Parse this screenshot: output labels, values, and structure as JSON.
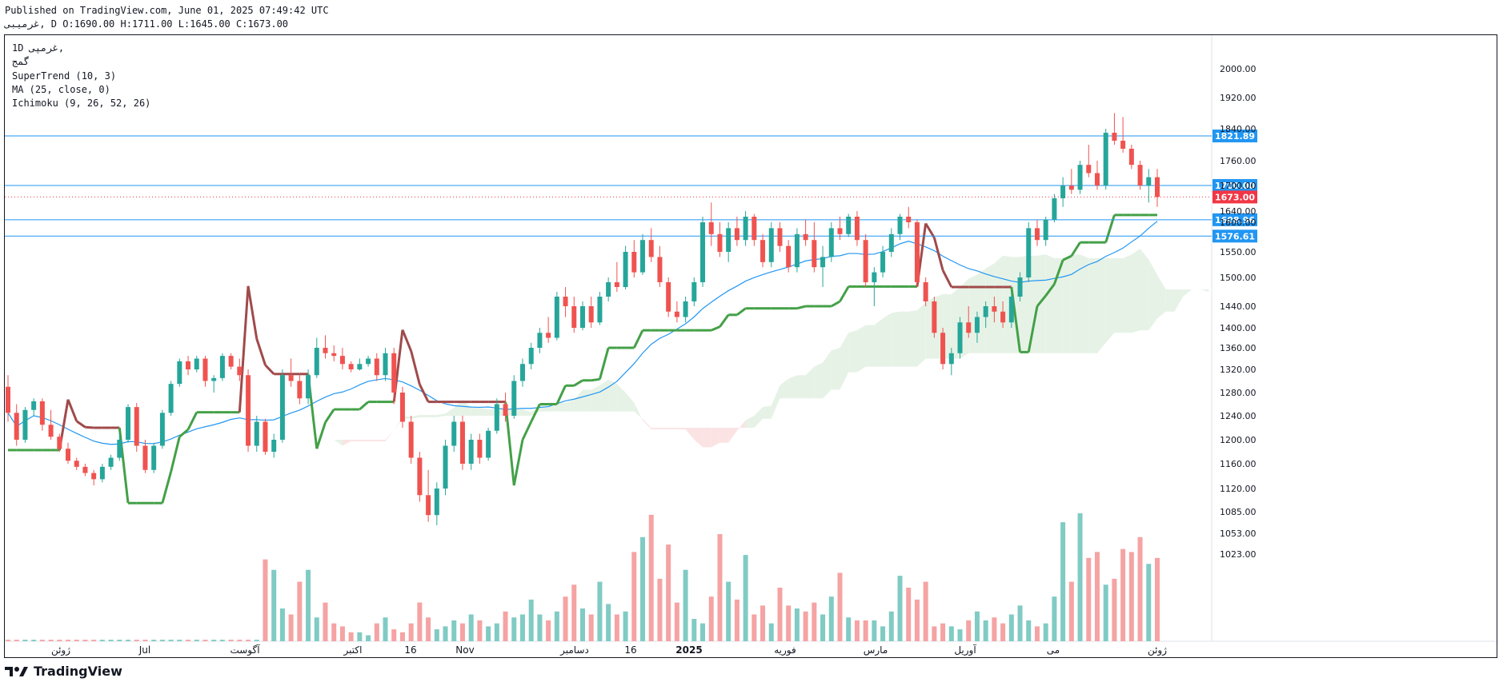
{
  "header": {
    "published": "Published on TradingView.com, June 01, 2025 07:49:42 UTC",
    "ohlc": "غرميبی, D O:1690.00 H:1711.00 L:1645.00 C:1673.00"
  },
  "legend": {
    "interval": "1D  غرمپی,",
    "symbol_name": "گمج",
    "supertrend": "SuperTrend (10, 3)",
    "ma": "MA (25, close, 0)",
    "ichimoku": "Ichimoku (9, 26, 52, 26)"
  },
  "brand": {
    "name": "TradingView",
    "icon": "tradingview-logo-icon"
  },
  "colors": {
    "up": "#26a69a",
    "down": "#ef5350",
    "supertrend_up": "#43a047",
    "supertrend_down": "#a04a4a",
    "ma": "#2196f3",
    "hline": "#2196f3",
    "cloud_bull": "#e6f2e6",
    "cloud_bear": "#fbe3e3",
    "last_price": "#f23645"
  },
  "chart_data": {
    "type": "candlestick",
    "y_axis": {
      "ticks": [
        2000,
        1920,
        1840,
        1760,
        1700,
        1640,
        1600,
        1550,
        1500,
        1440,
        1400,
        1360,
        1320,
        1280,
        1240,
        1200,
        1160,
        1120,
        1085,
        1053,
        1023
      ],
      "tick_labels": [
        "2000.00",
        "1920.00",
        "1840.00",
        "1760.00",
        "1700.00",
        "1640.00",
        "1600.00",
        "1550.00",
        "1500.00",
        "1440.00",
        "1400.00",
        "1360.00",
        "1320.00",
        "1280.00",
        "1240.00",
        "1200.00",
        "1160.00",
        "1120.00",
        "1085.00",
        "1053.00",
        "1023.00"
      ],
      "scale": "log"
    },
    "x_axis": {
      "tick_labels": [
        "ژوئن",
        "Jul",
        "آگوست",
        "اکتبر",
        "16",
        "Nov",
        "دسامبر",
        "16",
        "2025",
        "فوریه",
        "مارس",
        "آوریل",
        "می",
        "ژوئن"
      ]
    },
    "horizontal_lines": [
      {
        "value": 1821.89,
        "label": "1821.89"
      },
      {
        "value": 1700.0,
        "label": "1700.00"
      },
      {
        "value": 1608.96,
        "label": "1608.96"
      },
      {
        "value": 1576.61,
        "label": "1576.61"
      }
    ],
    "last_price": {
      "value": 1673.0,
      "label": "1673.00"
    },
    "candles": [
      [
        1290,
        1310,
        1230,
        1245
      ],
      [
        1245,
        1260,
        1190,
        1200
      ],
      [
        1200,
        1255,
        1195,
        1250
      ],
      [
        1250,
        1270,
        1240,
        1265
      ],
      [
        1265,
        1270,
        1215,
        1225
      ],
      [
        1225,
        1250,
        1200,
        1205
      ],
      [
        1205,
        1210,
        1180,
        1185
      ],
      [
        1185,
        1195,
        1160,
        1165
      ],
      [
        1165,
        1170,
        1150,
        1155
      ],
      [
        1155,
        1160,
        1140,
        1145
      ],
      [
        1145,
        1150,
        1125,
        1135
      ],
      [
        1135,
        1160,
        1130,
        1155
      ],
      [
        1155,
        1175,
        1150,
        1170
      ],
      [
        1170,
        1210,
        1165,
        1200
      ],
      [
        1200,
        1260,
        1195,
        1255
      ],
      [
        1255,
        1262,
        1180,
        1190
      ],
      [
        1190,
        1200,
        1145,
        1150
      ],
      [
        1150,
        1195,
        1145,
        1190
      ],
      [
        1190,
        1250,
        1185,
        1245
      ],
      [
        1245,
        1300,
        1240,
        1295
      ],
      [
        1295,
        1340,
        1290,
        1335
      ],
      [
        1335,
        1345,
        1310,
        1320
      ],
      [
        1320,
        1345,
        1315,
        1340
      ],
      [
        1340,
        1345,
        1290,
        1300
      ],
      [
        1300,
        1310,
        1280,
        1305
      ],
      [
        1305,
        1350,
        1300,
        1345
      ],
      [
        1345,
        1350,
        1320,
        1325
      ],
      [
        1325,
        1340,
        1300,
        1310
      ],
      [
        1310,
        1320,
        1180,
        1190
      ],
      [
        1190,
        1240,
        1180,
        1230
      ],
      [
        1230,
        1235,
        1175,
        1180
      ],
      [
        1180,
        1210,
        1170,
        1200
      ],
      [
        1200,
        1320,
        1195,
        1310
      ],
      [
        1310,
        1340,
        1290,
        1300
      ],
      [
        1300,
        1310,
        1260,
        1270
      ],
      [
        1270,
        1320,
        1260,
        1310
      ],
      [
        1310,
        1380,
        1305,
        1360
      ],
      [
        1360,
        1385,
        1340,
        1350
      ],
      [
        1350,
        1365,
        1335,
        1345
      ],
      [
        1345,
        1360,
        1320,
        1330
      ],
      [
        1330,
        1335,
        1315,
        1320
      ],
      [
        1320,
        1340,
        1318,
        1330
      ],
      [
        1330,
        1345,
        1325,
        1340
      ],
      [
        1340,
        1350,
        1300,
        1310
      ],
      [
        1310,
        1360,
        1300,
        1350
      ],
      [
        1350,
        1360,
        1260,
        1280
      ],
      [
        1280,
        1290,
        1220,
        1230
      ],
      [
        1230,
        1240,
        1160,
        1170
      ],
      [
        1170,
        1180,
        1100,
        1110
      ],
      [
        1110,
        1150,
        1070,
        1080
      ],
      [
        1080,
        1130,
        1065,
        1120
      ],
      [
        1120,
        1200,
        1110,
        1190
      ],
      [
        1190,
        1240,
        1180,
        1230
      ],
      [
        1230,
        1240,
        1150,
        1160
      ],
      [
        1160,
        1210,
        1150,
        1200
      ],
      [
        1200,
        1210,
        1160,
        1170
      ],
      [
        1170,
        1220,
        1165,
        1215
      ],
      [
        1215,
        1270,
        1210,
        1260
      ],
      [
        1260,
        1280,
        1230,
        1240
      ],
      [
        1240,
        1310,
        1235,
        1300
      ],
      [
        1300,
        1340,
        1290,
        1330
      ],
      [
        1330,
        1370,
        1320,
        1360
      ],
      [
        1360,
        1400,
        1350,
        1390
      ],
      [
        1390,
        1420,
        1370,
        1380
      ],
      [
        1380,
        1470,
        1375,
        1460
      ],
      [
        1460,
        1480,
        1420,
        1440
      ],
      [
        1440,
        1460,
        1390,
        1400
      ],
      [
        1400,
        1450,
        1395,
        1440
      ],
      [
        1440,
        1460,
        1400,
        1410
      ],
      [
        1410,
        1470,
        1405,
        1460
      ],
      [
        1460,
        1500,
        1450,
        1490
      ],
      [
        1490,
        1530,
        1470,
        1480
      ],
      [
        1480,
        1560,
        1475,
        1550
      ],
      [
        1550,
        1570,
        1500,
        1510
      ],
      [
        1510,
        1580,
        1505,
        1570
      ],
      [
        1570,
        1590,
        1530,
        1540
      ],
      [
        1540,
        1560,
        1480,
        1490
      ],
      [
        1490,
        1500,
        1420,
        1430
      ],
      [
        1430,
        1450,
        1410,
        1420
      ],
      [
        1420,
        1460,
        1410,
        1450
      ],
      [
        1450,
        1500,
        1440,
        1490
      ],
      [
        1490,
        1620,
        1480,
        1600
      ],
      [
        1600,
        1660,
        1560,
        1580
      ],
      [
        1580,
        1600,
        1540,
        1550
      ],
      [
        1550,
        1600,
        1530,
        1590
      ],
      [
        1590,
        1620,
        1560,
        1570
      ],
      [
        1570,
        1640,
        1560,
        1620
      ],
      [
        1620,
        1630,
        1560,
        1570
      ],
      [
        1570,
        1580,
        1520,
        1530
      ],
      [
        1530,
        1600,
        1520,
        1590
      ],
      [
        1590,
        1600,
        1550,
        1560
      ],
      [
        1560,
        1570,
        1510,
        1520
      ],
      [
        1520,
        1590,
        1510,
        1580
      ],
      [
        1580,
        1610,
        1560,
        1570
      ],
      [
        1570,
        1600,
        1510,
        1520
      ],
      [
        1520,
        1560,
        1480,
        1540
      ],
      [
        1540,
        1600,
        1530,
        1590
      ],
      [
        1590,
        1620,
        1570,
        1580
      ],
      [
        1580,
        1630,
        1575,
        1620
      ],
      [
        1620,
        1640,
        1560,
        1570
      ],
      [
        1570,
        1580,
        1480,
        1490
      ],
      [
        1490,
        1520,
        1440,
        1510
      ],
      [
        1510,
        1560,
        1500,
        1550
      ],
      [
        1550,
        1590,
        1540,
        1580
      ],
      [
        1580,
        1630,
        1570,
        1620
      ],
      [
        1620,
        1650,
        1590,
        1600
      ],
      [
        1600,
        1610,
        1480,
        1490
      ],
      [
        1490,
        1500,
        1440,
        1450
      ],
      [
        1450,
        1460,
        1380,
        1390
      ],
      [
        1390,
        1400,
        1320,
        1330
      ],
      [
        1330,
        1360,
        1310,
        1350
      ],
      [
        1350,
        1420,
        1340,
        1410
      ],
      [
        1410,
        1440,
        1380,
        1390
      ],
      [
        1390,
        1430,
        1370,
        1420
      ],
      [
        1420,
        1450,
        1400,
        1440
      ],
      [
        1440,
        1460,
        1410,
        1430
      ],
      [
        1430,
        1450,
        1400,
        1410
      ],
      [
        1410,
        1470,
        1400,
        1460
      ],
      [
        1460,
        1510,
        1450,
        1500
      ],
      [
        1500,
        1600,
        1490,
        1590
      ],
      [
        1590,
        1610,
        1560,
        1570
      ],
      [
        1570,
        1620,
        1560,
        1610
      ],
      [
        1610,
        1680,
        1600,
        1670
      ],
      [
        1670,
        1720,
        1650,
        1700
      ],
      [
        1700,
        1740,
        1680,
        1690
      ],
      [
        1690,
        1760,
        1680,
        1750
      ],
      [
        1750,
        1800,
        1720,
        1730
      ],
      [
        1730,
        1760,
        1690,
        1700
      ],
      [
        1700,
        1840,
        1690,
        1830
      ],
      [
        1830,
        1880,
        1800,
        1810
      ],
      [
        1810,
        1870,
        1780,
        1790
      ],
      [
        1790,
        1800,
        1740,
        1750
      ],
      [
        1750,
        1760,
        1690,
        1700
      ],
      [
        1700,
        1740,
        1660,
        1720
      ],
      [
        1720,
        1740,
        1650,
        1673
      ]
    ],
    "volume": [
      1,
      1,
      1,
      1,
      1,
      1,
      1,
      1,
      1,
      1,
      1,
      1,
      1,
      1,
      1,
      1,
      1,
      1,
      1,
      1,
      1,
      1,
      1,
      1,
      1,
      1,
      1,
      1,
      1,
      1,
      55,
      48,
      22,
      18,
      40,
      48,
      16,
      26,
      12,
      10,
      6,
      6,
      4,
      12,
      16,
      8,
      6,
      12,
      26,
      16,
      8,
      10,
      14,
      12,
      18,
      14,
      10,
      12,
      20,
      16,
      18,
      28,
      18,
      14,
      20,
      30,
      38,
      22,
      18,
      40,
      25,
      18,
      20,
      60,
      70,
      85,
      42,
      65,
      26,
      48,
      15,
      12,
      30,
      72,
      40,
      28,
      58,
      18,
      24,
      12,
      36,
      24,
      22,
      20,
      26,
      18,
      30,
      46,
      16,
      14,
      14,
      14,
      10,
      20,
      44,
      36,
      28,
      40,
      10,
      12,
      10,
      8,
      14,
      20,
      14,
      16,
      12,
      18,
      24,
      14,
      10,
      12,
      30,
      80,
      40,
      86,
      56,
      60,
      38,
      42,
      62,
      60,
      70,
      52,
      56,
      58,
      34,
      20,
      16,
      12
    ]
  }
}
